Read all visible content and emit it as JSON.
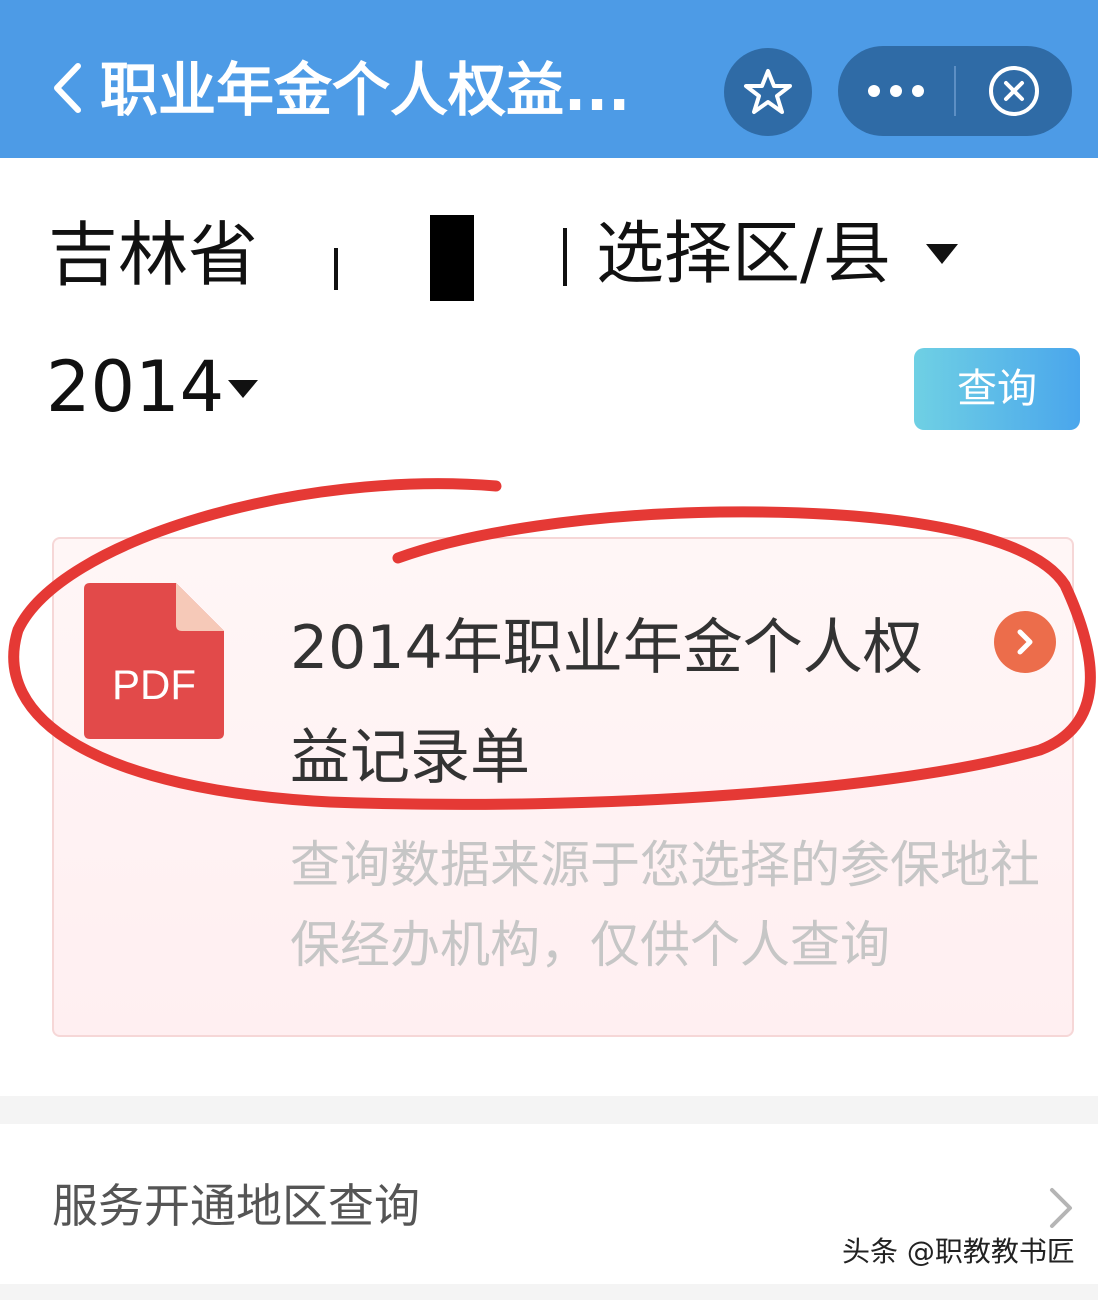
{
  "navbar": {
    "back_icon": "chevron-left-icon",
    "title": "职业年金个人权益...",
    "star_icon": "star-icon",
    "more_icon": "more-dots-icon",
    "close_icon": "close-circle-icon",
    "color": "#4d9be6"
  },
  "filters": {
    "province": "吉林省",
    "district": "选择区/县",
    "year": "2014",
    "query_label": "查询"
  },
  "result_card": {
    "icon": "pdf-file-icon",
    "icon_text": "PDF",
    "title": "2014年职业年金个人权益记录单",
    "arrow_icon": "chevron-right-circle-icon",
    "note": "查询数据来源于您选择的参保地社保经办机构，仅供个人查询"
  },
  "service": {
    "label": "服务开通地区查询",
    "chevron_icon": "chevron-right-icon"
  },
  "watermark": "头条 @职教教书匠",
  "colors": {
    "accent_red": "#e53935",
    "pdf_red": "#e24a4a",
    "arrow_orange": "#ec6d4b",
    "query_gradient": [
      "#6fd0e4",
      "#4aa6ec"
    ]
  }
}
